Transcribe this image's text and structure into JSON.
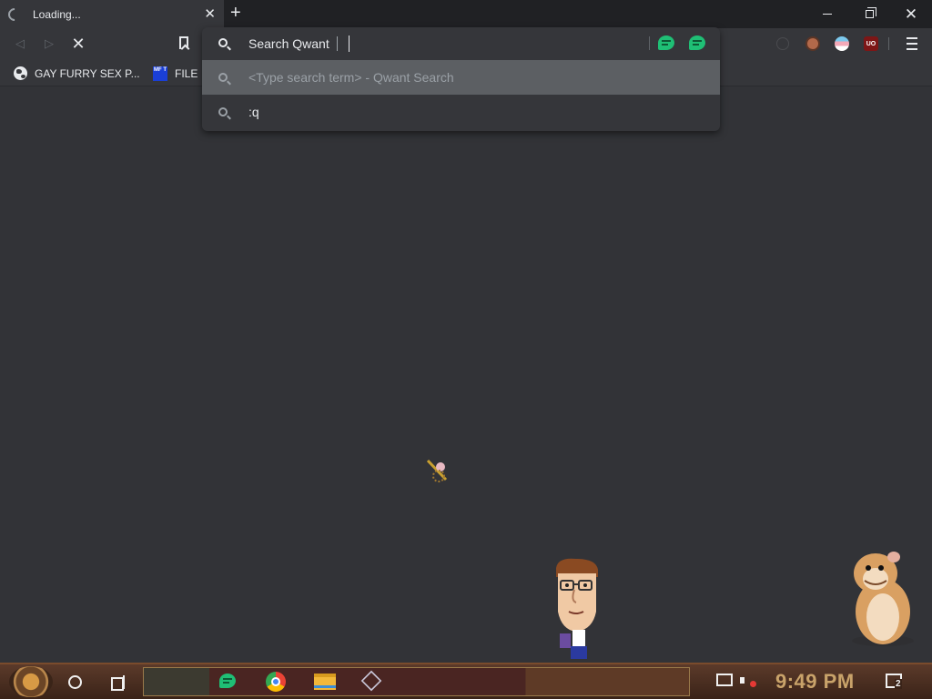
{
  "browser": {
    "tab": {
      "title": "Loading..."
    },
    "toolbar": {
      "extensions": [
        "puzzle-extension-icon",
        "avatar-extension-icon",
        "flag-extension-icon",
        "ublock-extension-icon"
      ],
      "ublock_badge": "UO"
    },
    "bookmarks": [
      {
        "label": "GAY FURRY SEX P...",
        "icon": "globe-icon"
      },
      {
        "label": "FILE",
        "icon": "mft-icon",
        "icon_text": "MF T"
      }
    ],
    "omnibox": {
      "keyword": "Search Qwant",
      "value": "",
      "suggestions": [
        {
          "text": "<Type search term> - Qwant Search",
          "selected": true
        },
        {
          "text": ":q",
          "selected": false
        }
      ]
    }
  },
  "taskbar": {
    "pinned": [
      "guilded-icon",
      "chrome-icon",
      "file-explorer-icon",
      "virtualbox-icon"
    ],
    "clock": "9:49 PM",
    "notification_count": "2"
  },
  "colors": {
    "page_bg": "#323337",
    "chrome_bg": "#35363a",
    "tabstrip_bg": "#202124",
    "selected_suggestion": "#5c5f63",
    "accent_green": "#1fbf75",
    "clock": "#c9a36a"
  }
}
